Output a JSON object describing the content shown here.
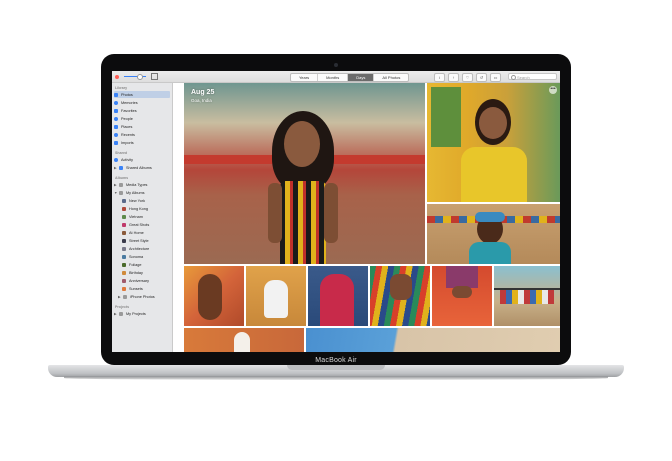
{
  "toolbar": {
    "view_tabs": [
      "Years",
      "Months",
      "Days",
      "All Photos"
    ],
    "active_tab": "Days",
    "search_placeholder": "Search"
  },
  "sidebar": {
    "library_header": "Library",
    "library_items": [
      "Photos",
      "Memories",
      "Favorites",
      "People",
      "Places",
      "Recents",
      "Imports"
    ],
    "shared_header": "Shared",
    "shared_items": [
      "Activity",
      "Shared Albums"
    ],
    "albums_header": "Albums",
    "media_types": "Media Types",
    "my_albums": "My Albums",
    "album_items": [
      "New York",
      "Hong Kong",
      "Vietnam",
      "Great Shots",
      "At Home",
      "Street Style",
      "Architecture",
      "Sonoma",
      "Foliage",
      "Birthday",
      "Anniversary",
      "Sunsets",
      "iPhone Photos"
    ],
    "projects_header": "Projects",
    "my_projects": "My Projects"
  },
  "photo_header": {
    "date": "Aug 25",
    "location": "Goa, India"
  },
  "device": {
    "label": "MacBook Air"
  },
  "colors": {
    "accent": "#3a82f6",
    "sidebar_bg": "#e6e7e9",
    "selected_item": "#bfcfe6"
  }
}
